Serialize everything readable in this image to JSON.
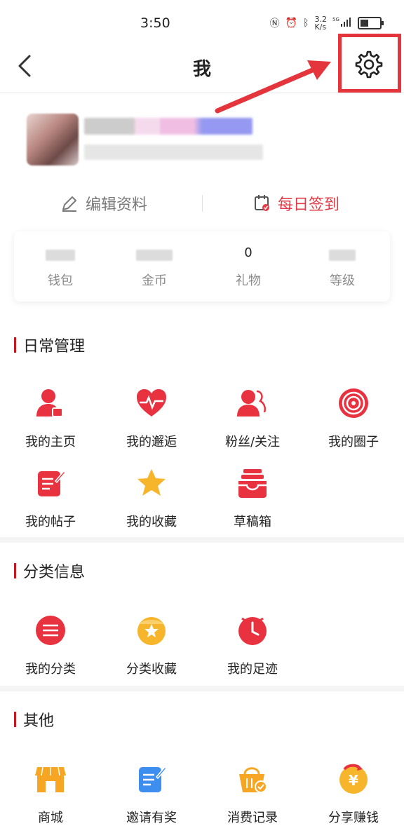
{
  "status": {
    "time": "3:50",
    "net": "3.2\nK/s",
    "sig": "5G"
  },
  "header": {
    "title": "我"
  },
  "actions": {
    "edit": "编辑资料",
    "sign": "每日签到"
  },
  "stats": [
    {
      "label": "钱包",
      "value": ""
    },
    {
      "label": "金币",
      "value": ""
    },
    {
      "label": "礼物",
      "value": "0"
    },
    {
      "label": "等级",
      "value": ""
    }
  ],
  "sections": [
    {
      "title": "日常管理",
      "items": [
        "我的主页",
        "我的邂逅",
        "粉丝/关注",
        "我的圈子",
        "我的帖子",
        "我的收藏",
        "草稿箱"
      ]
    },
    {
      "title": "分类信息",
      "items": [
        "我的分类",
        "分类收藏",
        "我的足迹"
      ]
    },
    {
      "title": "其他",
      "items": [
        "商城",
        "邀请有奖",
        "消费记录",
        "分享赚钱"
      ]
    }
  ],
  "colors": {
    "accent_red": "#e23b47",
    "highlight_box": "#e4343c",
    "section_bar": "#c9161e"
  }
}
